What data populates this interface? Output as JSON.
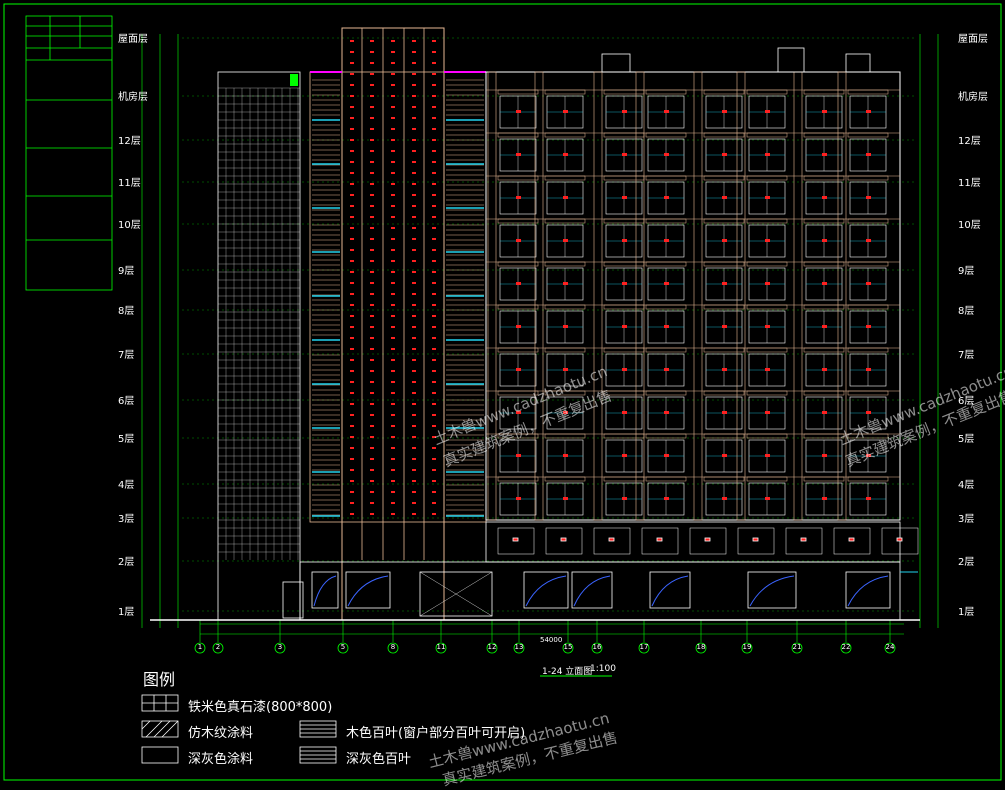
{
  "drawing": {
    "floors": [
      "屋面层",
      "机房层",
      "12层",
      "11层",
      "10层",
      "9层",
      "8层",
      "7层",
      "6层",
      "5层",
      "4层",
      "3层",
      "2层",
      "1层"
    ],
    "floor_rows_y": [
      30,
      88,
      132,
      174,
      216,
      262,
      302,
      346,
      392,
      430,
      476,
      510,
      553,
      603
    ],
    "axis_labels": [
      "1",
      "2",
      "3",
      "5",
      "8",
      "11",
      "12",
      "13",
      "15",
      "16",
      "17",
      "18",
      "19",
      "21",
      "22",
      "24"
    ],
    "axis_x": [
      200,
      218,
      280,
      343,
      393,
      441,
      492,
      519,
      568,
      597,
      644,
      701,
      747,
      797,
      846,
      890
    ],
    "elevation_title": "1-24 立面图",
    "scale": "1:100",
    "total_dim": "54000"
  },
  "legend": {
    "title": "图例",
    "items": [
      {
        "label": "铁米色真石漆(800*800)"
      },
      {
        "label": "仿木纹涂料"
      },
      {
        "label": "木色百叶(窗户部分百叶可开启)"
      },
      {
        "label": "深灰色涂料"
      },
      {
        "label": "深灰色百叶"
      }
    ]
  },
  "watermarks": [
    {
      "text": "土木兽www.cadzhaotu.cn"
    },
    {
      "text": "真实建筑案例，不重复出售"
    }
  ],
  "colors": {
    "line_white": "#ffffff",
    "line_green": "#00ff00",
    "window_red": "#ff2020",
    "panel_tan": "#e6b894",
    "glass_cyan": "#22d3ee",
    "blue": "#3b64ff",
    "magenta": "#ff00ff"
  }
}
